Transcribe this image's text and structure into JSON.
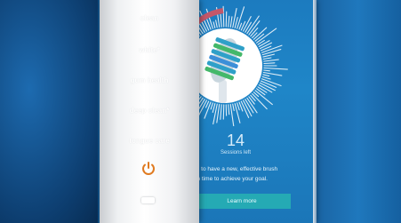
{
  "handle": {
    "modes": [
      "clean",
      "white*",
      "gum health",
      "deep clean*",
      "tongue care"
    ],
    "power_icon": "power-icon",
    "battery_icon": "battery-icon"
  },
  "app": {
    "sessions_count": "14",
    "sessions_label": "Sessions left",
    "message_line1": "now, to have a new, effective brush",
    "message_line2": "ad in time to achieve your goal.",
    "learn_more": "Learn more",
    "colors": {
      "accent": "#25aab4",
      "screen": "#1f86c8",
      "progress": "#c3576a"
    }
  }
}
